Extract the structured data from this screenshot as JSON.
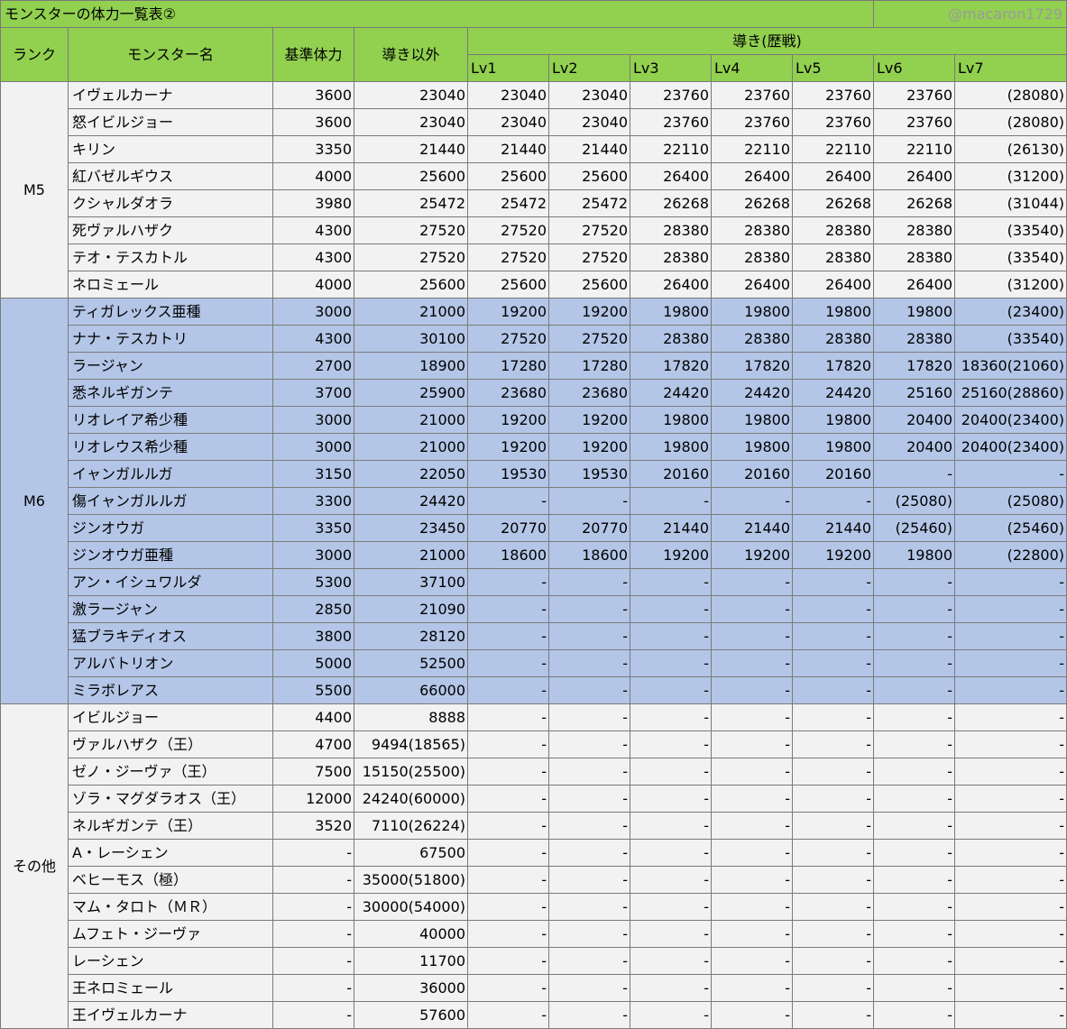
{
  "title": "モンスターの体力一覧表②",
  "credit": "@macaron1729",
  "headers": {
    "rank": "ランク",
    "name": "モンスター名",
    "base": "基準体力",
    "non_guiding": "導き以外",
    "guiding": "導き(歴戦)",
    "levels": [
      "Lv1",
      "Lv2",
      "Lv3",
      "Lv4",
      "Lv5",
      "Lv6",
      "Lv7"
    ]
  },
  "groups": [
    {
      "rank": "M5",
      "rows": [
        [
          "イヴェルカーナ",
          "3600",
          "23040",
          "23040",
          "23040",
          "23760",
          "23760",
          "23760",
          "23760",
          "(28080)"
        ],
        [
          "怒イビルジョー",
          "3600",
          "23040",
          "23040",
          "23040",
          "23760",
          "23760",
          "23760",
          "23760",
          "(28080)"
        ],
        [
          "キリン",
          "3350",
          "21440",
          "21440",
          "21440",
          "22110",
          "22110",
          "22110",
          "22110",
          "(26130)"
        ],
        [
          "紅バゼルギウス",
          "4000",
          "25600",
          "25600",
          "25600",
          "26400",
          "26400",
          "26400",
          "26400",
          "(31200)"
        ],
        [
          "クシャルダオラ",
          "3980",
          "25472",
          "25472",
          "25472",
          "26268",
          "26268",
          "26268",
          "26268",
          "(31044)"
        ],
        [
          "死ヴァルハザク",
          "4300",
          "27520",
          "27520",
          "27520",
          "28380",
          "28380",
          "28380",
          "28380",
          "(33540)"
        ],
        [
          "テオ・テスカトル",
          "4300",
          "27520",
          "27520",
          "27520",
          "28380",
          "28380",
          "28380",
          "28380",
          "(33540)"
        ],
        [
          "ネロミェール",
          "4000",
          "25600",
          "25600",
          "25600",
          "26400",
          "26400",
          "26400",
          "26400",
          "(31200)"
        ]
      ]
    },
    {
      "rank": "M6",
      "rows": [
        [
          "ティガレックス亜種",
          "3000",
          "21000",
          "19200",
          "19200",
          "19800",
          "19800",
          "19800",
          "19800",
          "(23400)"
        ],
        [
          "ナナ・テスカトリ",
          "4300",
          "30100",
          "27520",
          "27520",
          "28380",
          "28380",
          "28380",
          "28380",
          "(33540)"
        ],
        [
          "ラージャン",
          "2700",
          "18900",
          "17280",
          "17280",
          "17820",
          "17820",
          "17820",
          "17820",
          "18360(21060)"
        ],
        [
          "悉ネルギガンテ",
          "3700",
          "25900",
          "23680",
          "23680",
          "24420",
          "24420",
          "24420",
          "25160",
          "25160(28860)"
        ],
        [
          "リオレイア希少種",
          "3000",
          "21000",
          "19200",
          "19200",
          "19800",
          "19800",
          "19800",
          "20400",
          "20400(23400)"
        ],
        [
          "リオレウス希少種",
          "3000",
          "21000",
          "19200",
          "19200",
          "19800",
          "19800",
          "19800",
          "20400",
          "20400(23400)"
        ],
        [
          "イャンガルルガ",
          "3150",
          "22050",
          "19530",
          "19530",
          "20160",
          "20160",
          "20160",
          "-",
          "-"
        ],
        [
          "傷イャンガルルガ",
          "3300",
          "24420",
          "-",
          "-",
          "-",
          "-",
          "-",
          "(25080)",
          "(25080)"
        ],
        [
          "ジンオウガ",
          "3350",
          "23450",
          "20770",
          "20770",
          "21440",
          "21440",
          "21440",
          "(25460)",
          "(25460)"
        ],
        [
          "ジンオウガ亜種",
          "3000",
          "21000",
          "18600",
          "18600",
          "19200",
          "19200",
          "19200",
          "19800",
          "(22800)"
        ],
        [
          "アン・イシュワルダ",
          "5300",
          "37100",
          "-",
          "-",
          "-",
          "-",
          "-",
          "-",
          "-"
        ],
        [
          "激ラージャン",
          "2850",
          "21090",
          "-",
          "-",
          "-",
          "-",
          "-",
          "-",
          "-"
        ],
        [
          "猛ブラキディオス",
          "3800",
          "28120",
          "-",
          "-",
          "-",
          "-",
          "-",
          "-",
          "-"
        ],
        [
          "アルバトリオン",
          "5000",
          "52500",
          "-",
          "-",
          "-",
          "-",
          "-",
          "-",
          "-"
        ],
        [
          "ミラボレアス",
          "5500",
          "66000",
          "-",
          "-",
          "-",
          "-",
          "-",
          "-",
          "-"
        ]
      ]
    },
    {
      "rank": "その他",
      "rows": [
        [
          "イビルジョー",
          "4400",
          "8888",
          "-",
          "-",
          "-",
          "-",
          "-",
          "-",
          "-"
        ],
        [
          "ヴァルハザク（王）",
          "4700",
          "9494(18565)",
          "-",
          "-",
          "-",
          "-",
          "-",
          "-",
          "-"
        ],
        [
          "ゼノ・ジーヴァ（王）",
          "7500",
          "15150(25500)",
          "-",
          "-",
          "-",
          "-",
          "-",
          "-",
          "-"
        ],
        [
          "ゾラ・マグダラオス（王）",
          "12000",
          "24240(60000)",
          "-",
          "-",
          "-",
          "-",
          "-",
          "-",
          "-"
        ],
        [
          "ネルギガンテ（王）",
          "3520",
          "7110(26224)",
          "-",
          "-",
          "-",
          "-",
          "-",
          "-",
          "-"
        ],
        [
          "A・レーシェン",
          "-",
          "67500",
          "-",
          "-",
          "-",
          "-",
          "-",
          "-",
          "-"
        ],
        [
          "ベヒーモス（極）",
          "-",
          "35000(51800)",
          "-",
          "-",
          "-",
          "-",
          "-",
          "-",
          "-"
        ],
        [
          "マム・タロト（ＭＲ）",
          "-",
          "30000(54000)",
          "-",
          "-",
          "-",
          "-",
          "-",
          "-",
          "-"
        ],
        [
          "ムフェト・ジーヴァ",
          "-",
          "40000",
          "-",
          "-",
          "-",
          "-",
          "-",
          "-",
          "-"
        ],
        [
          "レーシェン",
          "-",
          "11700",
          "-",
          "-",
          "-",
          "-",
          "-",
          "-",
          "-"
        ],
        [
          "王ネロミェール",
          "-",
          "36000",
          "-",
          "-",
          "-",
          "-",
          "-",
          "-",
          "-"
        ],
        [
          "王イヴェルカーナ",
          "-",
          "57600",
          "-",
          "-",
          "-",
          "-",
          "-",
          "-",
          "-"
        ]
      ]
    }
  ]
}
